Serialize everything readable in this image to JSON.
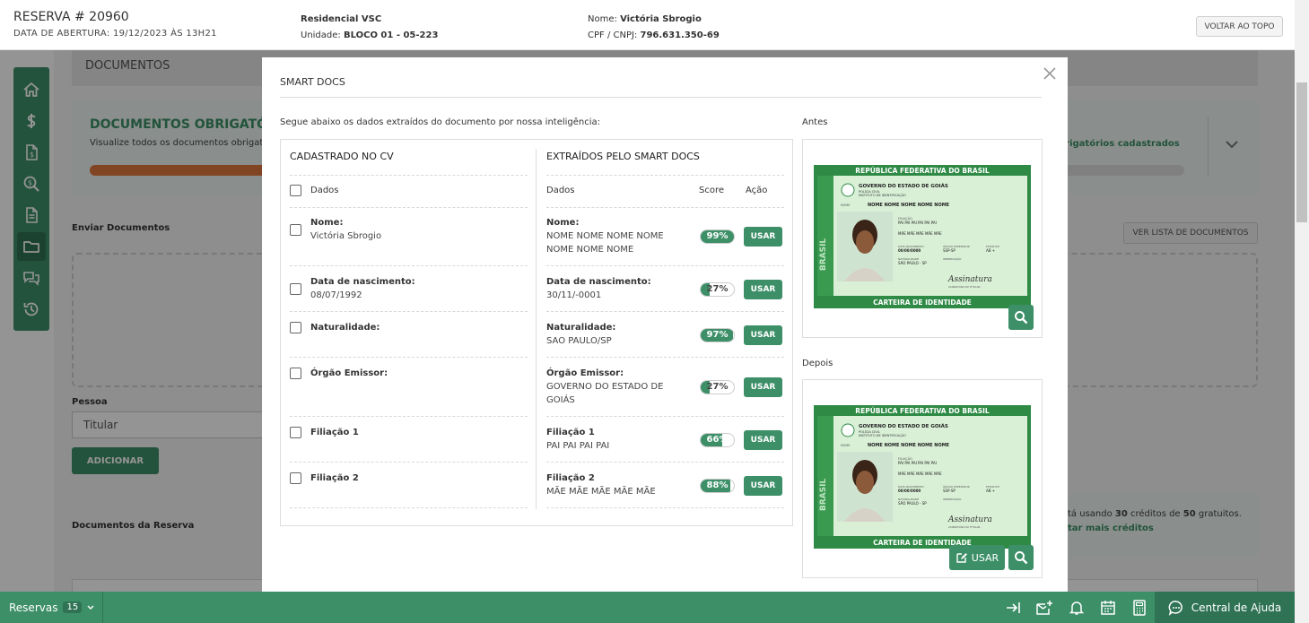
{
  "header": {
    "reserva": "RESERVA # 20960",
    "data_abertura": "DATA DE ABERTURA: 19/12/2023 ÀS 13H21",
    "empreendimento": "Residencial VSC",
    "unidade_label": "Unidade:",
    "unidade": "BLOCO 01 - 05-223",
    "nome_label": "Nome:",
    "nome": "Victória Sbrogio",
    "cpf_label": "CPF / CNPJ:",
    "cpf": "796.631.350-69",
    "voltar": "VOLTAR AO TOPO"
  },
  "background": {
    "section_title": "DOCUMENTOS",
    "docs_title": "DOCUMENTOS OBRIGATÓRIO",
    "docs_subtitle": "Visualize todos os documentos obrigat",
    "docs_right": "brigatórios cadastrados",
    "enviar": "Enviar Documentos",
    "ver_lista": "VER LISTA DE DOCUMENTOS",
    "pessoa": "Pessoa",
    "pessoa_value": "Titular",
    "adicionar": "ADICIONAR",
    "docs_reserva": "Documentos da Reserva",
    "credits_pre": "tá usando ",
    "credits_used": "30",
    "credits_mid": " créditos de ",
    "credits_total": "50",
    "credits_post": " gratuitos.",
    "credits_link": "tar mais créditos"
  },
  "sidebar": {
    "icons": [
      "home-icon",
      "dollar-icon",
      "invoice-icon",
      "search-dollar-icon",
      "document-icon",
      "folder-icon",
      "chat-icon",
      "history-icon"
    ],
    "active": "folder-icon"
  },
  "modal": {
    "title": "SMART DOCS",
    "subtitle": "Segue abaixo os dados extraídos do documento por nossa inteligência:",
    "left_title": "CADASTRADO NO CV",
    "right_title": "EXTRAÍDOS PELO SMART DOCS",
    "dados_label": "Dados",
    "score_label": "Score",
    "acao_label": "Ação",
    "usar_label": "USAR",
    "antes": "Antes",
    "depois": "Depois",
    "img_usar": "USAR",
    "rows": [
      {
        "label": "Nome:",
        "cv_value": "Victória Sbrogio",
        "extracted": "NOME NOME NOME NOME NOME NOME NOME",
        "score": "99%",
        "score_value": 99
      },
      {
        "label": "Data de nascimento:",
        "cv_value": "08/07/1992",
        "extracted": "30/11/-0001",
        "score": "27%",
        "score_value": 27
      },
      {
        "label": "Naturalidade:",
        "cv_value": "",
        "extracted": "SAO PAULO/SP",
        "score": "97%",
        "score_value": 97
      },
      {
        "label": "Órgão Emissor:",
        "cv_value": "",
        "extracted": "GOVERNO DO ESTADO DE GOIÁS",
        "score": "27%",
        "score_value": 27
      },
      {
        "label": "Filiação 1",
        "cv_value": "",
        "extracted": "PAI PAI PAI PAI",
        "score": "66%",
        "score_value": 66
      },
      {
        "label": "Filiação 2",
        "cv_value": "",
        "extracted": "MÃE MÃE MÃE MÃE MÃE",
        "score": "88%",
        "score_value": 88
      }
    ]
  },
  "idcard": {
    "top": "REPÚBLICA FEDERATIVA DO BRASIL",
    "gov": "GOVERNO DO ESTADO DE GOIÁS",
    "sub1": "POLÍCIA CIVIL",
    "sub2": "INSTITUTO DE IDENTIFICAÇÃO",
    "nome_lbl": "NOME",
    "nome": "NOME NOME NOME NOME NOME",
    "filiacao_lbl": "FILIAÇÃO",
    "pai": "PAI PAI PAI PAI PAI PAI",
    "mae": "MÃE MÃE MÃE MÃE MÃE",
    "dn_lbl": "DATA NASCIMENTO",
    "dn": "00/00/0000",
    "org_lbl": "ÓRGÃO EXPEDIDOR",
    "org": "SSP-SP",
    "fator_lbl": "FATOR RH",
    "fator": "AB +",
    "nat_lbl": "NATURALIDADE",
    "nat": "SÃO PAULO - SP",
    "obs_lbl": "OBSERVAÇÃO",
    "assinatura": "Assinatura",
    "ass_lbl": "ASSINATURA DO TITULAR",
    "side": "BRASIL",
    "bottom": "CARTEIRA DE IDENTIDADE"
  },
  "bottombar": {
    "reservas": "Reservas",
    "count": "15",
    "icons": [
      "sidebar-collapse-icon",
      "add-notification-icon",
      "bell-icon",
      "calendar-icon",
      "calculator-icon"
    ],
    "help": "Central de Ajuda"
  },
  "colors": {
    "primary": "#3d8f68",
    "primary_dark": "#2f7354",
    "progress": "#e0783d"
  }
}
